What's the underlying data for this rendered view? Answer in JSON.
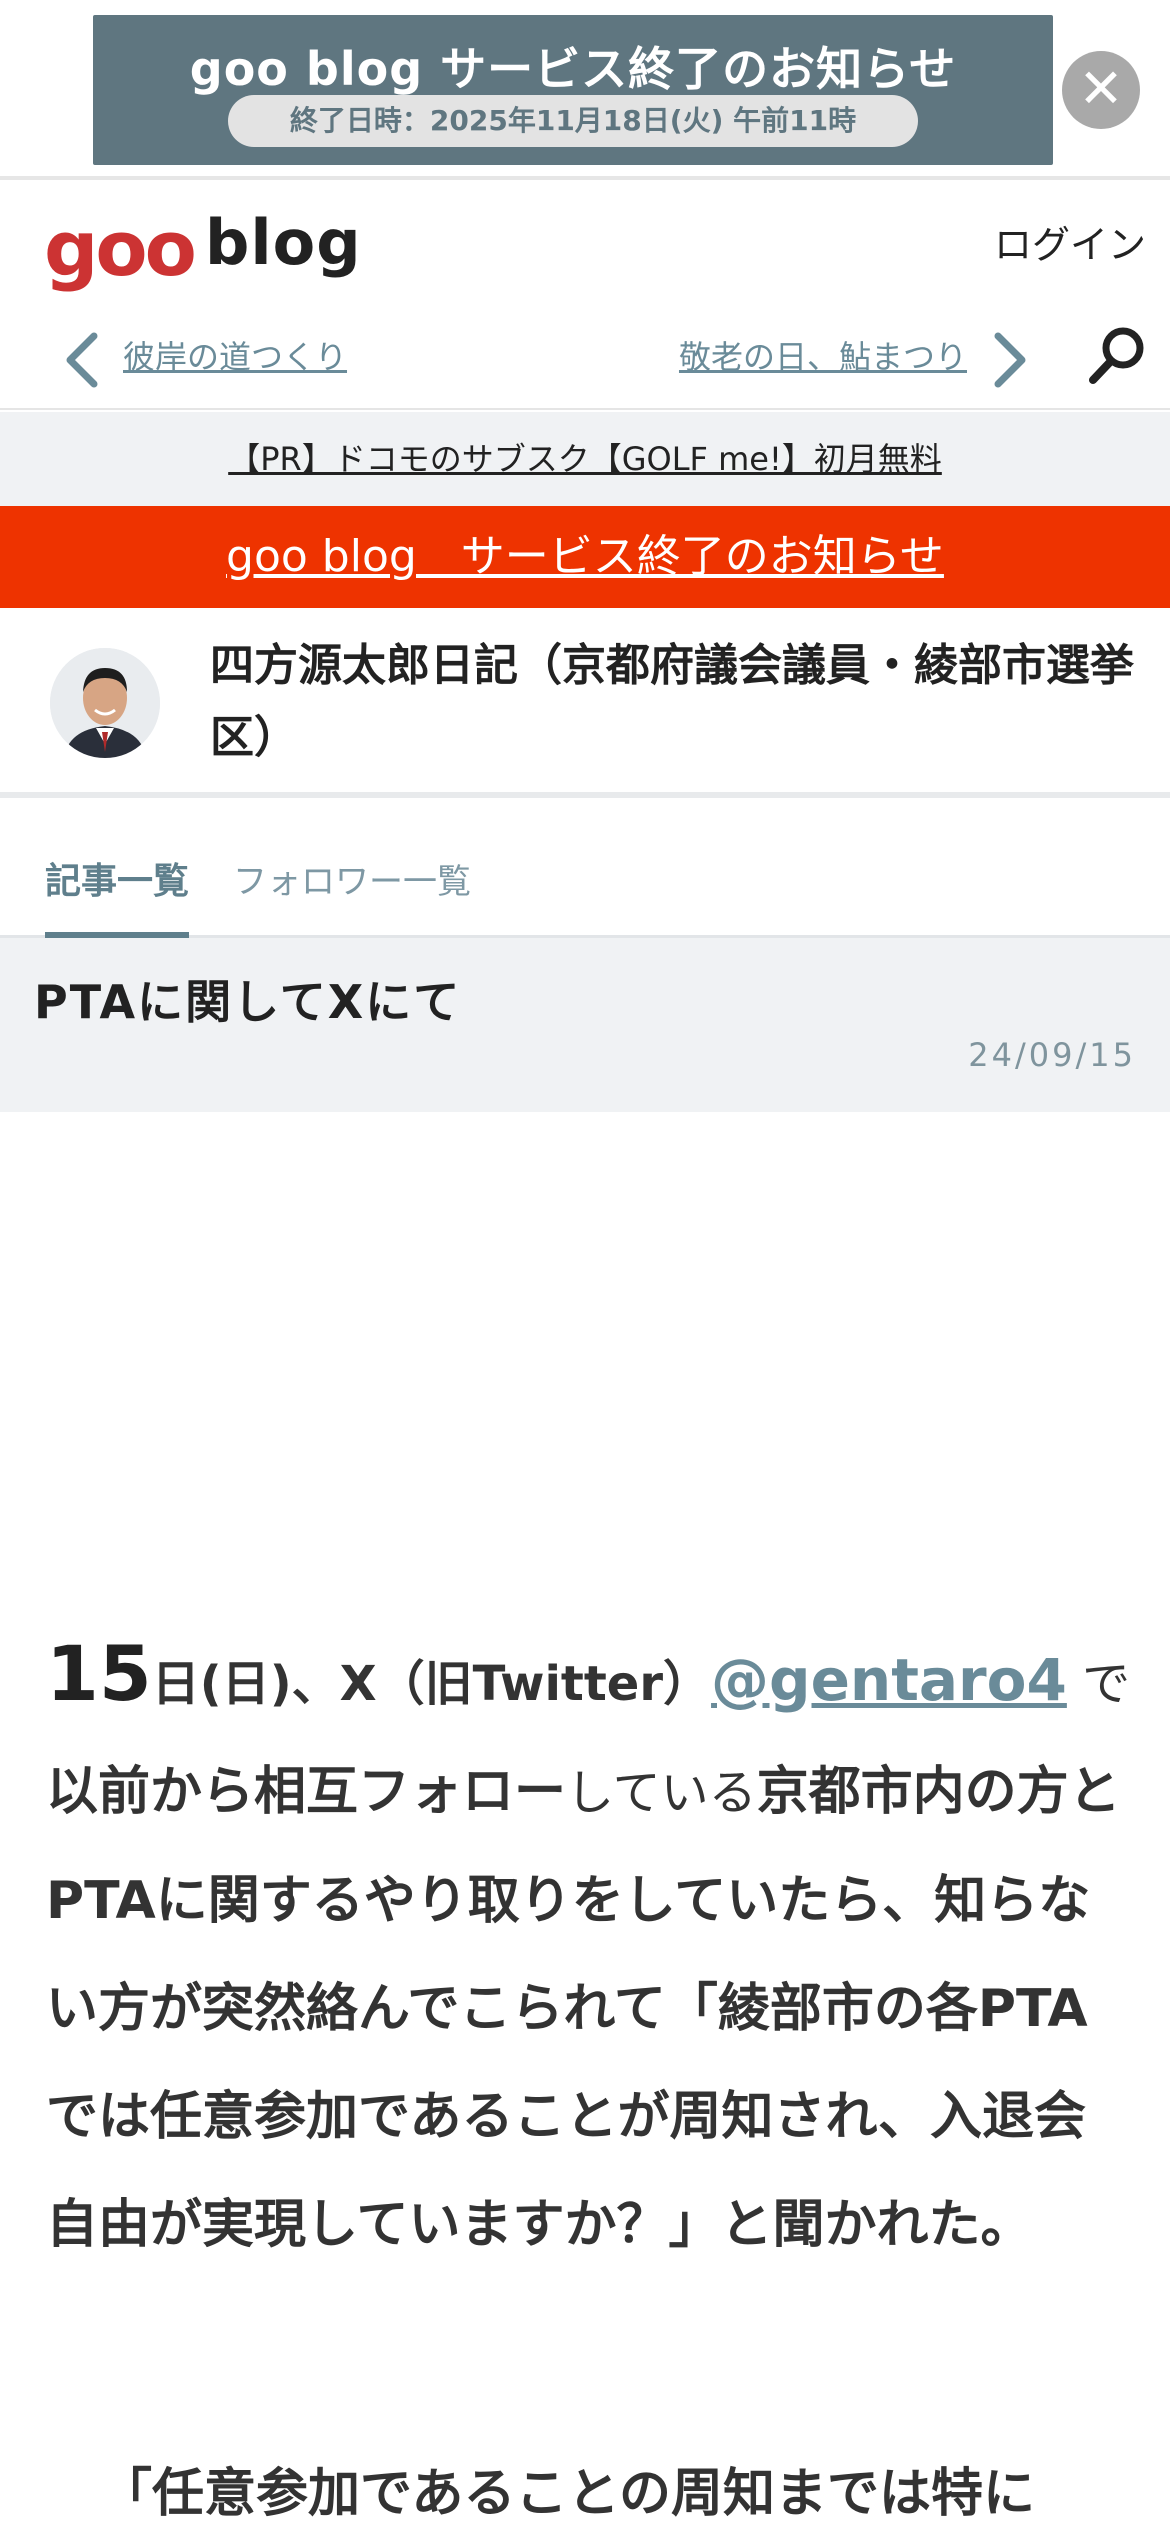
{
  "banner": {
    "title": "goo blog サービス終了のお知らせ",
    "date_text": "終了日時：2025年11月18日(火) 午前11時",
    "close_symbol": "✕"
  },
  "header": {
    "logo_goo": "goo",
    "logo_blog": "blog",
    "login": "ログイン",
    "prev_entry": "彼岸の道つくり",
    "next_entry": "敬老の日、鮎まつり"
  },
  "pr": {
    "text": "【PR】ドコモのサブスク【GOLF me!】初月無料"
  },
  "notice": {
    "text": "goo blog　サービス終了のお知らせ"
  },
  "blog": {
    "title": "四方源太郎日記（京都府議会議員・綾部市選挙区）"
  },
  "tabs": [
    {
      "label": "記事一覧",
      "active": true
    },
    {
      "label": "フォロワー一覧",
      "active": false
    }
  ],
  "entry": {
    "title": "PTAに関してXにて",
    "date": "24/09/15"
  },
  "article": {
    "p1_day_num": "15",
    "p1_day_rest": "日(日)、X（旧Twitter）",
    "p1_handle": "@gentaro4",
    "p1_de": " で",
    "p1_line2a": "以前から相互フォロー",
    "p1_line2b": "している",
    "p1_line2c": "京都市内の",
    "p1_rest": "方とPTAに関するやり取りをしていたら、知らない方が突然絡んでこられて「綾部市の各PTAでは任意参加であることが周知され、入退会自由が実現していますか？」と聞かれた。",
    "p2": "「任意参加であることの周知までは特に"
  },
  "colors": {
    "accent": "#5f7f8c",
    "notice_red": "#ee3300",
    "logo_red": "#cc3333",
    "banner_bg": "#5f7680"
  }
}
